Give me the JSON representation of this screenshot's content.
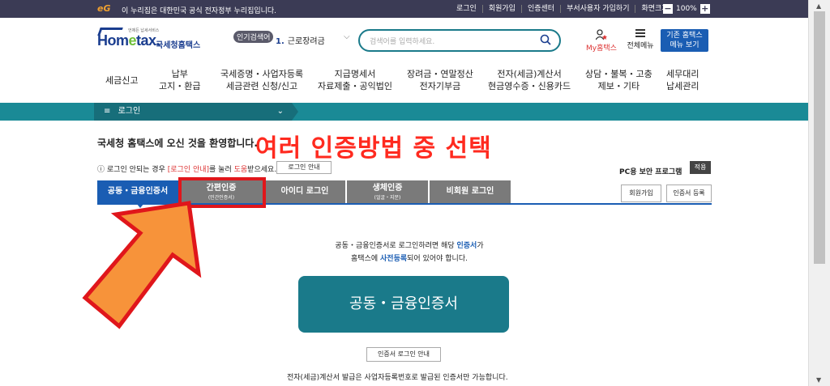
{
  "govbar": {
    "logo": "eG",
    "notice": "이 누리집은 대한민국 공식 전자정부 누리집입니다.",
    "links": [
      "로그인",
      "회원가입",
      "인증센터",
      "부서사용자 가입하기",
      "화면크기"
    ],
    "zoom_minus": "−",
    "zoom_value": "100%",
    "zoom_plus": "+"
  },
  "header": {
    "logo_text_1": "Hom",
    "logo_text_e": "e",
    "logo_text_2": "tax.",
    "logo_tagline": "언제든 납세서비스",
    "logo_korean": "국세청홈택스",
    "popular_label": "인기검색어",
    "popular_num": "1.",
    "popular_kw": "근로장려금",
    "search_placeholder": "검색어를 입력하세요.",
    "myhome": "My홈택스",
    "allmenu": "전체메뉴",
    "oldhome_1": "기존 홈택스",
    "oldhome_2": "메뉴 보기"
  },
  "gnb": [
    {
      "l1": "세금신고",
      "l2": ""
    },
    {
      "l1": "납부",
      "l2": "고지・환급"
    },
    {
      "l1": "국세증명・사업자등록",
      "l2": "세금관련 신청/신고"
    },
    {
      "l1": "지급명세서",
      "l2": "자료제출・공익법인"
    },
    {
      "l1": "장려금・연말정산",
      "l2": "전자기부금"
    },
    {
      "l1": "전자(세금)계산서",
      "l2": "현금영수증・신용카드"
    },
    {
      "l1": "상담・불복・고충",
      "l2": "제보・기타"
    },
    {
      "l1": "세무대리",
      "l2": "납세관리"
    }
  ],
  "breadcrumb": {
    "icon": "≡",
    "label": "로그인",
    "chevron": "⌄"
  },
  "welcome": "국세청 홈택스에 오신 것을 환영합니다.",
  "overlay_title": "여러 인증방법 중 선택",
  "info": {
    "icon": "ⓘ",
    "pre": "로그인 안되는 경우",
    "link": "[로그인 안내]",
    "mid": "를 눌러",
    "help": "도움",
    "post": "받으세요.",
    "button": "로그인 안내"
  },
  "pc_security": {
    "label": "PC용 보안 프로그램",
    "button": "적용"
  },
  "tabs": [
    {
      "label": "공동・금융인증서",
      "sub": ""
    },
    {
      "label": "간편인증",
      "sub": "(민간인증서)"
    },
    {
      "label": "아이디 로그인",
      "sub": ""
    },
    {
      "label": "생체인증",
      "sub": "(얼굴・지문)"
    },
    {
      "label": "비회원 로그인",
      "sub": ""
    }
  ],
  "side_buttons": {
    "join": "회원가입",
    "cert_register": "인증서 등록"
  },
  "content": {
    "line1_pre": "공동・금융인증서로 로그인하려면 해당",
    "line1_b": "인증서",
    "line1_post": "가",
    "line2_pre": "홈택스에",
    "line2_b": "사전등록",
    "line2_post": "되어 있어야 합니다.",
    "cert_button": "공동・금융인증서",
    "guide_button": "인증서 로그인 안내",
    "footnote": "전자(세금)계산서 발급은 사업자등록번호로 발급된 인증서만 가능합니다."
  },
  "colors": {
    "teal": "#1a8a96",
    "blue": "#1a5db3",
    "red": "#e0161b",
    "arrow": "#f7933a"
  }
}
